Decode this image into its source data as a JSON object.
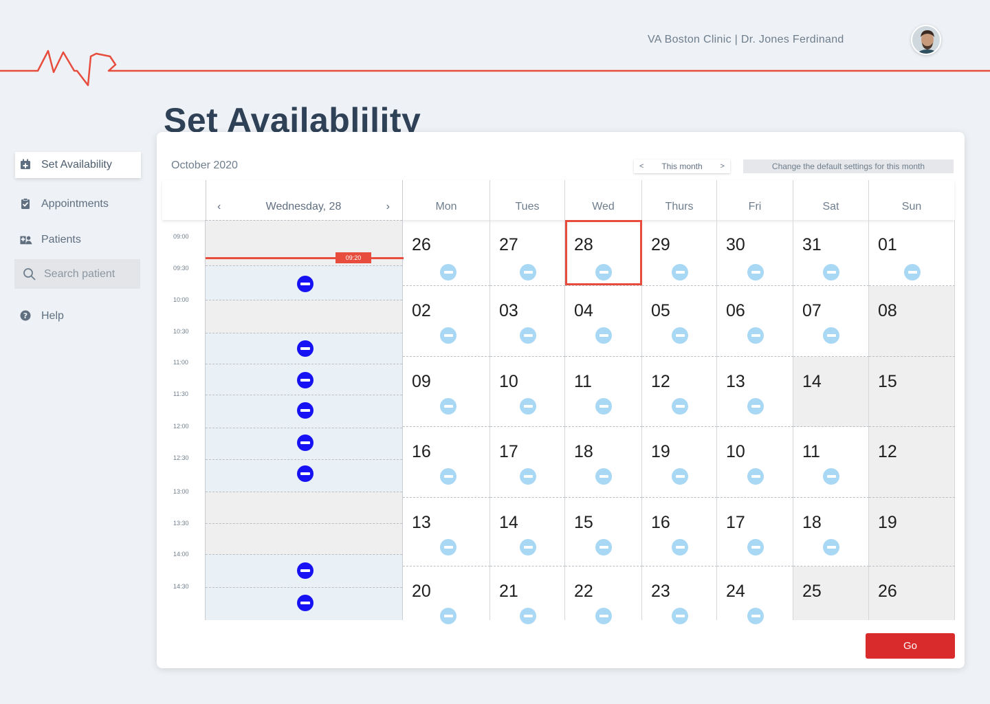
{
  "header": {
    "clinic_label": "VA Boston Clinic | Dr. Jones Ferdinand",
    "logo_color": "#e74c3c"
  },
  "page": {
    "title": "Set Availablility"
  },
  "sidebar": {
    "items": [
      {
        "label": "Set Availability",
        "icon": "calendar-plus-icon",
        "active": true
      },
      {
        "label": "Appointments",
        "icon": "clipboard-check-icon",
        "active": false
      },
      {
        "label": "Patients",
        "icon": "hospital-users-icon",
        "active": false
      },
      {
        "label": "Help",
        "icon": "question-circle-icon",
        "active": false
      }
    ],
    "search": {
      "placeholder": "Search patient",
      "value": ""
    }
  },
  "calendar": {
    "month_label": "October 2020",
    "month_nav": {
      "prev": "<",
      "label": "This month",
      "next": ">"
    },
    "defaults_button": "Change the default settings for this month",
    "day_view": {
      "prev": "‹",
      "label": "Wednesday, 28",
      "next": "›",
      "current_time": "09:20"
    },
    "weekdays": [
      "Mon",
      "Tues",
      "Wed",
      "Thurs",
      "Fri",
      "Sat",
      "Sun"
    ],
    "times": [
      "09:00",
      "09:30",
      "10:00",
      "10:30",
      "11:00",
      "11:30",
      "12:00",
      "12:30",
      "13:00",
      "13:30",
      "14:00",
      "14:30"
    ],
    "weeks": [
      [
        "26",
        "27",
        "28",
        "29",
        "30",
        "31",
        "01"
      ],
      [
        "02",
        "03",
        "04",
        "05",
        "06",
        "07",
        "08"
      ],
      [
        "09",
        "10",
        "11",
        "12",
        "13",
        "14",
        "15"
      ],
      [
        "16",
        "17",
        "18",
        "19",
        "10",
        "11",
        "12"
      ],
      [
        "13",
        "14",
        "15",
        "16",
        "17",
        "18",
        "19"
      ],
      [
        "20",
        "21",
        "22",
        "23",
        "24",
        "25",
        "26"
      ]
    ],
    "selected_date": "28",
    "accent_color": "#e74c3c",
    "block_color": "#1712f5",
    "unavailable_color": "#a8d8f4"
  },
  "actions": {
    "go_label": "Go"
  }
}
